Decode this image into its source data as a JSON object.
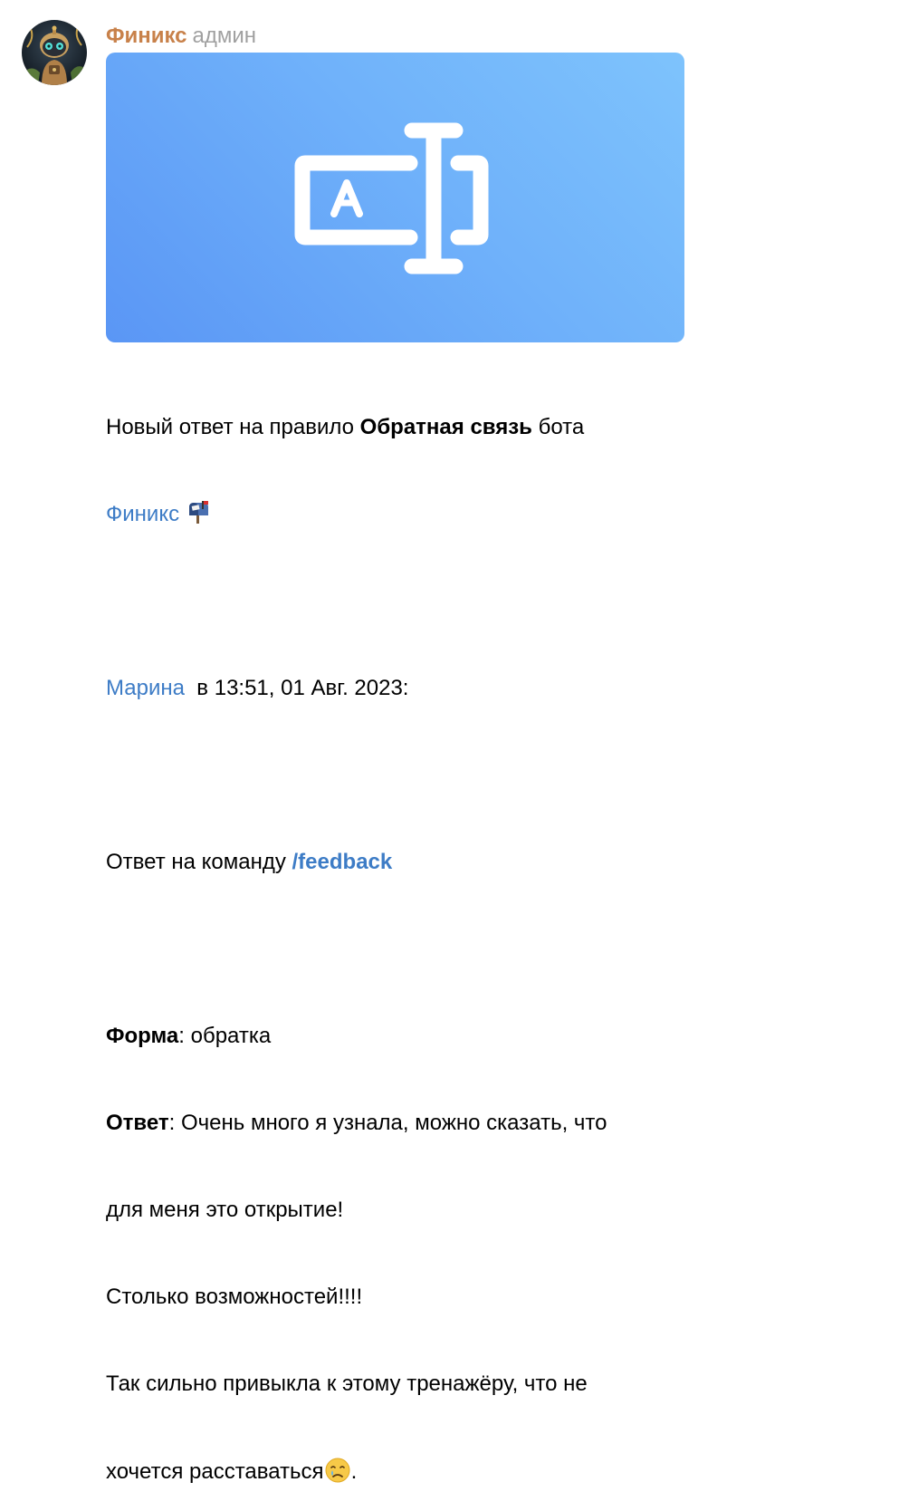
{
  "message": {
    "author": "Финикс",
    "role": "админ",
    "banner_icon": "text-field-icon",
    "intro_prefix": "Новый ответ на правило ",
    "rule_name": "Обратная связь",
    "intro_suffix": " бота",
    "bot_link": "Финикс",
    "mailbox_emoji": "mailbox-icon",
    "sender_link": "Марина",
    "sender_time": "  в 13:51, 01 Авг. 2023:",
    "command_prefix": "Ответ на команду ",
    "command": "/feedback",
    "form_label": "Форма",
    "form_value": ": обратка",
    "answer_label": "Ответ",
    "answer_line1": ": Очень много я узнала, можно сказать, что",
    "answer_line2": "для меня это открытие!",
    "answer_line3": "Столько возможностей!!!!",
    "answer_line4": "Так сильно привыкла к этому тренажёру, что не",
    "answer_line5_text": "хочется расставаться",
    "answer_line5_end": ".",
    "crying_emoji": "crying-face-icon"
  },
  "colors": {
    "author": "#c8814a",
    "role": "#a0a0a0",
    "link": "#3d7cc6",
    "banner_start": "#5a96f5",
    "banner_end": "#7ec3fc"
  }
}
